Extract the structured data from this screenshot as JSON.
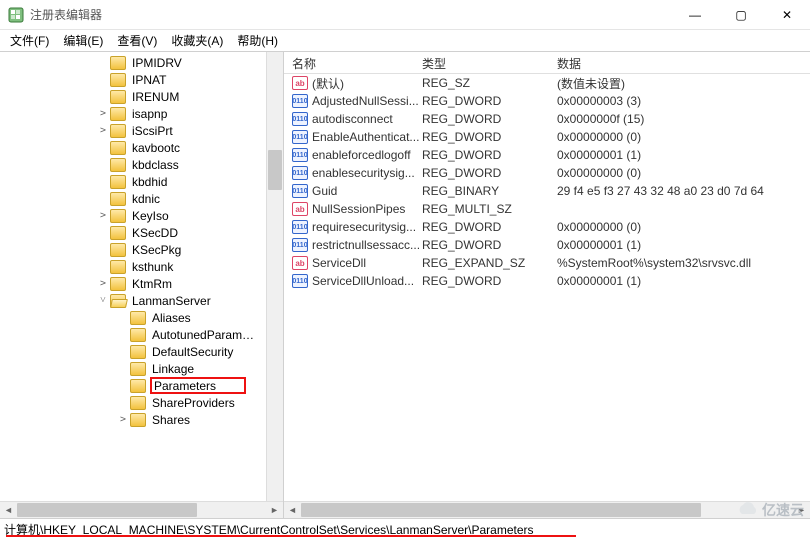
{
  "window": {
    "title": "注册表编辑器",
    "controls": {
      "min": "—",
      "max": "▢",
      "close": "✕"
    }
  },
  "menu": {
    "file": "文件(F)",
    "edit": "编辑(E)",
    "view": "查看(V)",
    "favorites": "收藏夹(A)",
    "help": "帮助(H)"
  },
  "tree": {
    "items": [
      {
        "indent": 96,
        "exp": "",
        "type": "folder",
        "label": "IPMIDRV"
      },
      {
        "indent": 96,
        "exp": "",
        "type": "folder",
        "label": "IPNAT"
      },
      {
        "indent": 96,
        "exp": "",
        "type": "folder",
        "label": "IRENUM"
      },
      {
        "indent": 96,
        "exp": ">",
        "type": "folder",
        "label": "isapnp"
      },
      {
        "indent": 96,
        "exp": ">",
        "type": "folder",
        "label": "iScsiPrt"
      },
      {
        "indent": 96,
        "exp": "",
        "type": "folder",
        "label": "kavbootc"
      },
      {
        "indent": 96,
        "exp": "",
        "type": "folder",
        "label": "kbdclass"
      },
      {
        "indent": 96,
        "exp": "",
        "type": "folder",
        "label": "kbdhid"
      },
      {
        "indent": 96,
        "exp": "",
        "type": "folder",
        "label": "kdnic"
      },
      {
        "indent": 96,
        "exp": ">",
        "type": "folder",
        "label": "KeyIso"
      },
      {
        "indent": 96,
        "exp": "",
        "type": "folder",
        "label": "KSecDD"
      },
      {
        "indent": 96,
        "exp": "",
        "type": "folder",
        "label": "KSecPkg"
      },
      {
        "indent": 96,
        "exp": "",
        "type": "folder",
        "label": "ksthunk"
      },
      {
        "indent": 96,
        "exp": ">",
        "type": "folder",
        "label": "KtmRm"
      },
      {
        "indent": 96,
        "exp": "v",
        "type": "folder-open",
        "label": "LanmanServer"
      },
      {
        "indent": 116,
        "exp": "",
        "type": "folder",
        "label": "Aliases"
      },
      {
        "indent": 116,
        "exp": "",
        "type": "folder",
        "label": "AutotunedParameters",
        "truncated": "AutotunedParam…"
      },
      {
        "indent": 116,
        "exp": "",
        "type": "folder",
        "label": "DefaultSecurity"
      },
      {
        "indent": 116,
        "exp": "",
        "type": "folder",
        "label": "Linkage"
      },
      {
        "indent": 116,
        "exp": "",
        "type": "folder",
        "label": "Parameters",
        "selected": true
      },
      {
        "indent": 116,
        "exp": "",
        "type": "folder",
        "label": "ShareProviders"
      },
      {
        "indent": 116,
        "exp": ">",
        "type": "folder",
        "label": "Shares"
      }
    ]
  },
  "columns": {
    "name": "名称",
    "type": "类型",
    "data": "数据"
  },
  "values": [
    {
      "icon": "str",
      "name": "(默认)",
      "type": "REG_SZ",
      "data": "(数值未设置)"
    },
    {
      "icon": "bin",
      "name": "AdjustedNullSessi...",
      "type": "REG_DWORD",
      "data": "0x00000003 (3)"
    },
    {
      "icon": "bin",
      "name": "autodisconnect",
      "type": "REG_DWORD",
      "data": "0x0000000f (15)"
    },
    {
      "icon": "bin",
      "name": "EnableAuthenticat...",
      "type": "REG_DWORD",
      "data": "0x00000000 (0)"
    },
    {
      "icon": "bin",
      "name": "enableforcedlogoff",
      "type": "REG_DWORD",
      "data": "0x00000001 (1)"
    },
    {
      "icon": "bin",
      "name": "enablesecuritysig...",
      "type": "REG_DWORD",
      "data": "0x00000000 (0)"
    },
    {
      "icon": "bin",
      "name": "Guid",
      "type": "REG_BINARY",
      "data": "29 f4 e5 f3 27 43 32 48 a0 23 d0 7d 64"
    },
    {
      "icon": "str",
      "name": "NullSessionPipes",
      "type": "REG_MULTI_SZ",
      "data": ""
    },
    {
      "icon": "bin",
      "name": "requiresecuritysig...",
      "type": "REG_DWORD",
      "data": "0x00000000 (0)"
    },
    {
      "icon": "bin",
      "name": "restrictnullsessacc...",
      "type": "REG_DWORD",
      "data": "0x00000001 (1)"
    },
    {
      "icon": "str",
      "name": "ServiceDll",
      "type": "REG_EXPAND_SZ",
      "data": "%SystemRoot%\\system32\\srvsvc.dll"
    },
    {
      "icon": "bin",
      "name": "ServiceDllUnload...",
      "type": "REG_DWORD",
      "data": "0x00000001 (1)"
    }
  ],
  "statusbar": {
    "path": "计算机\\HKEY_LOCAL_MACHINE\\SYSTEM\\CurrentControlSet\\Services\\LanmanServer\\Parameters"
  },
  "watermark": "亿速云",
  "icon_text": {
    "str": "ab",
    "bin": "011\n110"
  }
}
